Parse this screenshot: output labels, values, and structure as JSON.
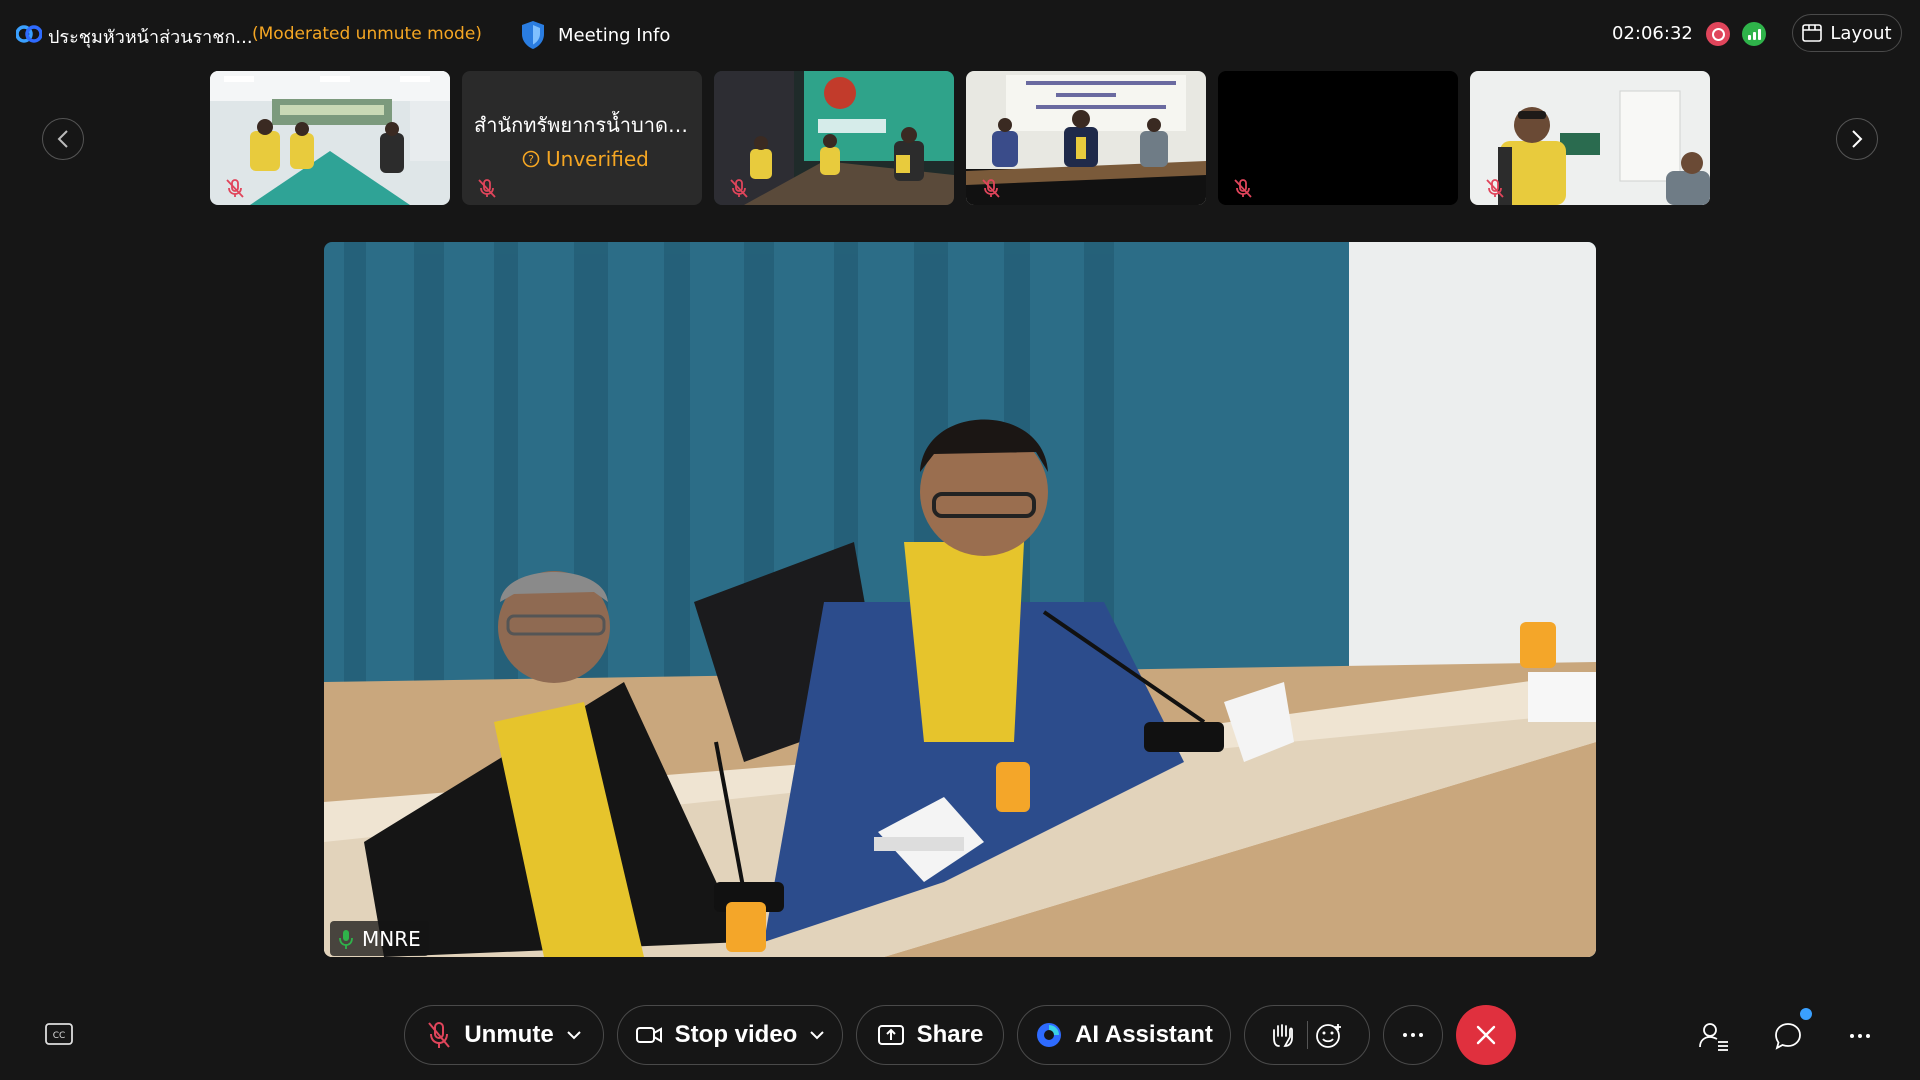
{
  "header": {
    "meeting_title": "ประชุมหัวหน้าส่วนราชก...",
    "mode": "(Moderated unmute mode)",
    "meeting_info_label": "Meeting Info",
    "elapsed_time": "02:06:32",
    "layout_label": "Layout"
  },
  "filmstrip": {
    "tiles": [
      {
        "type": "video",
        "muted": true
      },
      {
        "type": "text",
        "name": "สำนักทรัพยากรน้ำบาดา...",
        "status": "Unverified",
        "muted": true
      },
      {
        "type": "video",
        "muted": true
      },
      {
        "type": "video",
        "muted": true
      },
      {
        "type": "video-off",
        "muted": true
      },
      {
        "type": "video",
        "muted": true
      }
    ]
  },
  "stage": {
    "speaker_label": "MNRE"
  },
  "controls": {
    "unmute_label": "Unmute",
    "stop_video_label": "Stop video",
    "share_label": "Share",
    "ai_assistant_label": "AI Assistant"
  },
  "colors": {
    "accent_orange": "#f5a623",
    "end_red": "#e0303e",
    "record_red": "#e0455b",
    "network_green": "#2fb34a",
    "notification_blue": "#3aa0ff"
  }
}
